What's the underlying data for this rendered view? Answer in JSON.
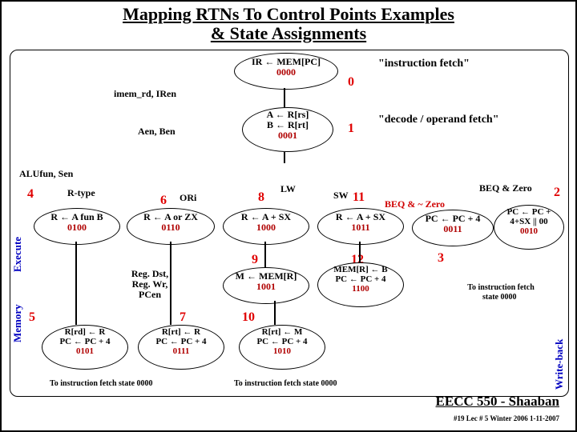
{
  "title_line1": "Mapping RTNs To Control Points Examples",
  "title_line2": "& State Assignments",
  "phase": {
    "fetch": "\"instruction fetch\"",
    "decode": "\"decode / operand fetch\"",
    "execute": "Execute",
    "memory": "Memory",
    "writeback": "Write-back"
  },
  "signals": {
    "imem": "imem_rd, IRen",
    "aen": "Aen, Ben",
    "alufun": "ALUfun, Sen",
    "regdst": "Reg. Dst, Reg. Wr, PCen"
  },
  "branch": {
    "rtype": "R-type",
    "ori": "ORi",
    "lw": "LW",
    "sw": "SW",
    "beqzero": "BEQ & Zero",
    "beqnzero": "BEQ & ~ Zero"
  },
  "states": {
    "s0": {
      "num": "0",
      "l1": "IR ← MEM[PC]",
      "l2": "0000"
    },
    "s1": {
      "num": "1",
      "l1": "A ← R[rs]",
      "l2": "B ← R[rt]",
      "l3": "0001"
    },
    "s4": {
      "num": "4",
      "l1": "R ← A fun B",
      "l2": "0100"
    },
    "s6": {
      "num": "6",
      "l1": "R ← A or ZX",
      "l2": "0110"
    },
    "s8": {
      "num": "8",
      "l1": "R ← A + SX",
      "l2": "1000"
    },
    "s11": {
      "num": "11",
      "l1": "R ← A + SX",
      "l2": "1011"
    },
    "s3pc4": {
      "l1": "PC ← PC + 4",
      "l2": "0011"
    },
    "s2": {
      "num": "2",
      "l1": "PC ← PC +",
      "l2": "4+SX || 00",
      "l3": "0010"
    },
    "s3num": "3",
    "s9": {
      "num": "9",
      "l1": "M ← MEM[R]",
      "l2": "1001"
    },
    "s12": {
      "num": "12",
      "l1": "MEM[R] ← B",
      "l2": "PC ← PC + 4",
      "l3": "1100"
    },
    "s5": {
      "num": "5",
      "l1": "R[rd] ← R",
      "l2": "PC ← PC + 4",
      "l3": "0101"
    },
    "s7": {
      "num": "7",
      "l1": "R[rt] ← R",
      "l2": "PC ← PC + 4",
      "l3": "0111"
    },
    "s10": {
      "num": "10",
      "l1": "R[rt] ← M",
      "l2": "PC ← PC + 4",
      "l3": "1010"
    }
  },
  "tofetch": "To instruction fetch state 0000",
  "tofetch_short": "To instruction fetch state 0000",
  "tofetch_tiny": "To instruction fetch",
  "tofetch_tiny2": "state 0000",
  "footer": {
    "course": "EECC 550 - Shaaban",
    "meta": "#19  Lec # 5  Winter 2006  1-11-2007"
  }
}
